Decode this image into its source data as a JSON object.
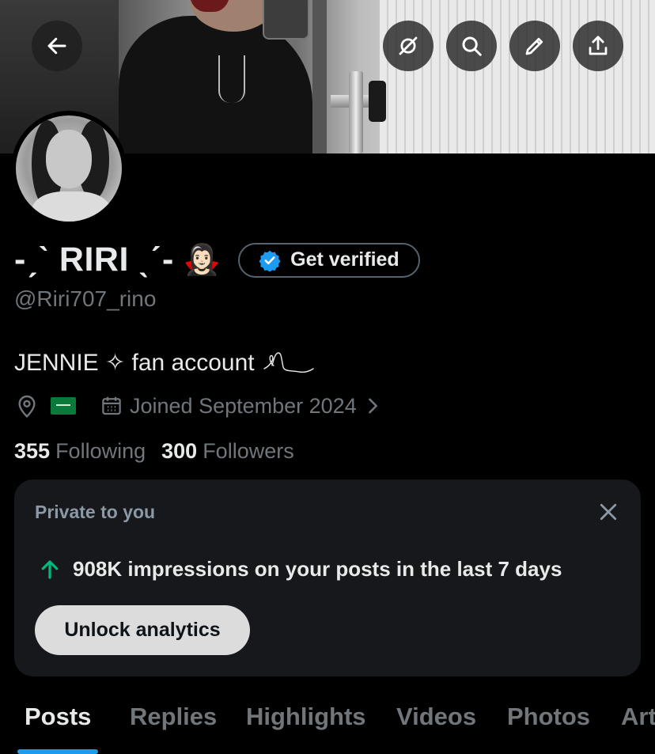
{
  "header": {
    "back_label": "Back",
    "icons": [
      "arrow-left-icon",
      "grok-icon",
      "search-icon",
      "pencil-icon",
      "share-icon"
    ]
  },
  "profile": {
    "display_name": "-ˏˋ RIRI ˎˊ-",
    "name_emoji": "🧛🏻‍♀️",
    "get_verified_label": "Get verified",
    "handle": "@Riri707_rino",
    "bio": "JENNIE ✧ fan account",
    "joined": "Joined September 2024",
    "following_count": "355",
    "following_label": "Following",
    "followers_count": "300",
    "followers_label": "Followers"
  },
  "analytics_card": {
    "title": "Private to you",
    "impressions_text": "908K impressions on your posts in the last 7 days",
    "unlock_label": "Unlock analytics"
  },
  "tabs": [
    {
      "label": "Posts",
      "active": true
    },
    {
      "label": "Replies",
      "active": false
    },
    {
      "label": "Highlights",
      "active": false
    },
    {
      "label": "Videos",
      "active": false
    },
    {
      "label": "Photos",
      "active": false
    },
    {
      "label": "Articles",
      "active": false
    }
  ],
  "colors": {
    "accent": "#1d9bf0",
    "impressions_arrow": "#00ba7c",
    "card_bg": "#16181c",
    "muted_text": "#71767b"
  }
}
